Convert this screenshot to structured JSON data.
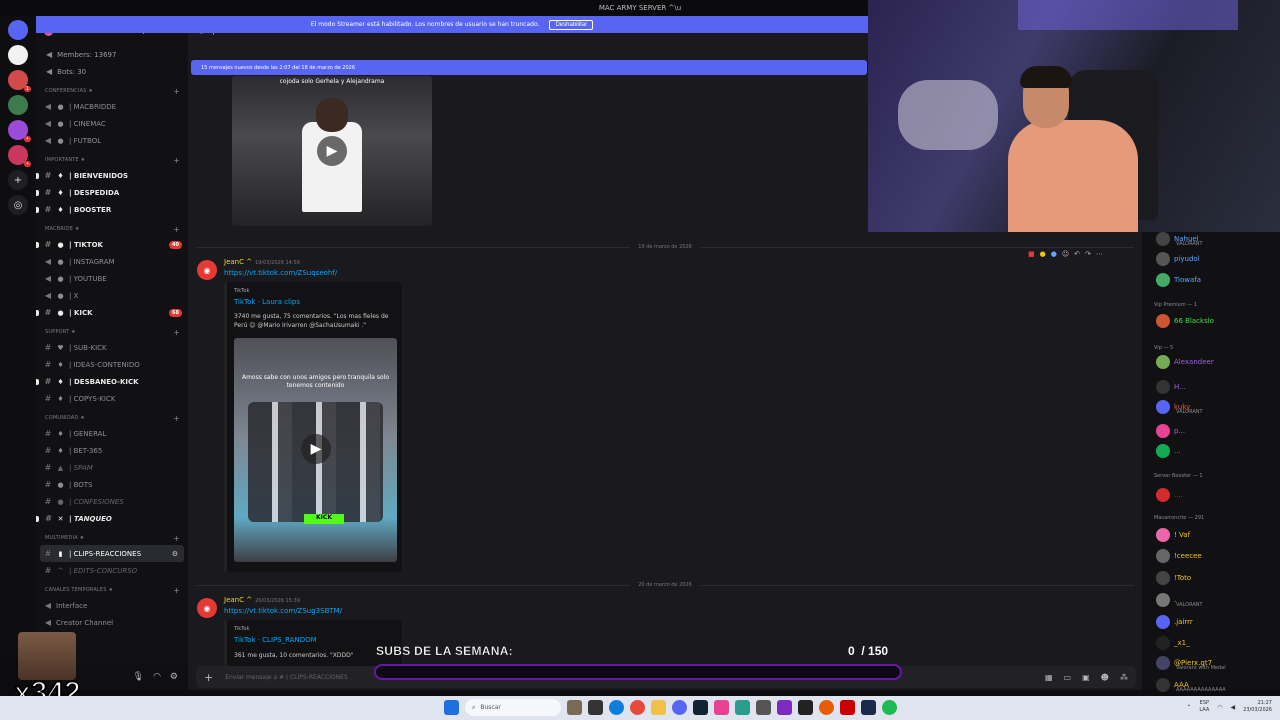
{
  "window": {
    "title": "MAC ARMY SERVER ^\\u"
  },
  "streamer_banner": {
    "text": "El modo Streamer está habilitado. Los nombres de usuario se han truncado.",
    "button": "Deshabilitar"
  },
  "server": {
    "name": "MAC ARMY SERVER ^\\u",
    "members": "Members: 13697",
    "bots": "Bots: 30"
  },
  "channel_header": {
    "name": "| CLIPS-REACCIONES"
  },
  "new_messages_bar": "15 mensajes nuevos desde las 2:07 del 18 de marzo de 2026",
  "sidebar": {
    "categories": [
      {
        "name": "CONFERENCIAS ★",
        "channels": [
          {
            "label": "| MACBRIDDE",
            "icon": "speaker-icon",
            "emoji": "●",
            "style": "normal"
          },
          {
            "label": "| CINEMAC",
            "icon": "speaker-icon",
            "emoji": "●",
            "style": "normal"
          },
          {
            "label": "| FUTBOL",
            "icon": "speaker-icon",
            "emoji": "●",
            "style": "normal"
          }
        ]
      },
      {
        "name": "IMPORTANTE ★",
        "channels": [
          {
            "label": "| BIENVENIDOS",
            "icon": "hash-icon",
            "emoji": "♦",
            "style": "bold"
          },
          {
            "label": "| DESPEDIDA",
            "icon": "hash-icon",
            "emoji": "♦",
            "style": "bold"
          },
          {
            "label": "| BOOSTER",
            "icon": "hash-icon",
            "emoji": "♦",
            "style": "bold"
          }
        ]
      },
      {
        "name": "MACBRIDE ★",
        "channels": [
          {
            "label": "| TIKTOK",
            "icon": "hash-icon",
            "emoji": "●",
            "style": "bold",
            "ping": "40"
          },
          {
            "label": "| INSTAGRAM",
            "icon": "speaker-icon",
            "emoji": "●",
            "style": "normal"
          },
          {
            "label": "| YOUTUBE",
            "icon": "speaker-icon",
            "emoji": "●",
            "style": "normal"
          },
          {
            "label": "| X",
            "icon": "speaker-icon",
            "emoji": "●",
            "style": "normal"
          },
          {
            "label": "| KICK",
            "icon": "hash-icon",
            "emoji": "●",
            "style": "bold",
            "ping": "68"
          }
        ]
      },
      {
        "name": "SUPPORT ★",
        "channels": [
          {
            "label": "| SUB-KICK",
            "icon": "hash-icon",
            "emoji": "♥",
            "style": "normal"
          },
          {
            "label": "| IDEAS-CONTENIDO",
            "icon": "hash-icon",
            "emoji": "♦",
            "style": "normal"
          },
          {
            "label": "| DESBANEO-KICK",
            "icon": "hash-icon",
            "emoji": "♦",
            "style": "bold"
          },
          {
            "label": "| COPYS-KICK",
            "icon": "hash-icon",
            "emoji": "♦",
            "style": "normal"
          }
        ]
      },
      {
        "name": "COMUNIDAD ★",
        "channels": [
          {
            "label": "| GENERAL",
            "icon": "hash-icon",
            "emoji": "♦",
            "style": "normal"
          },
          {
            "label": "| BET-365",
            "icon": "hash-icon",
            "emoji": "♦",
            "style": "normal"
          },
          {
            "label": "| SPAM",
            "icon": "hash-icon",
            "emoji": "▲",
            "style": "dim"
          },
          {
            "label": "| BOTS",
            "icon": "hash-icon",
            "emoji": "●",
            "style": "normal"
          },
          {
            "label": "| CONFESIONES",
            "icon": "hash-icon",
            "emoji": "●",
            "style": "italic"
          },
          {
            "label": "| TANQUEO",
            "icon": "hash-icon",
            "emoji": "✕",
            "style": "bold-italic"
          }
        ]
      },
      {
        "name": "MULTIMEDIA ★",
        "channels": [
          {
            "label": "| CLIPS-REACCIONES",
            "icon": "hash-icon",
            "emoji": "▮",
            "style": "active"
          },
          {
            "label": "| EDITS-CONCURSO",
            "icon": "hash-icon",
            "emoji": "^",
            "style": "italic"
          }
        ]
      },
      {
        "name": "CANALES TEMPORALES ★",
        "channels": [
          {
            "label": "Interface",
            "icon": "speaker-icon",
            "emoji": "",
            "style": "normal"
          },
          {
            "label": "Creator Channel",
            "icon": "speaker-icon",
            "emoji": "",
            "style": "normal"
          }
        ]
      }
    ]
  },
  "video1": {
    "caption": "cojoda solo Gerhela y Alejandrama"
  },
  "dates": [
    "19 de marzo de 2026",
    "20 de marzo de 2026"
  ],
  "message1": {
    "author": "JeanC ^",
    "timestamp": "19/03/2026 14:56",
    "link": "https://vt.tiktok.com/ZSuqseohf/",
    "embed_provider": "TikTok",
    "embed_title": "TikTok · Laura clips",
    "embed_desc_1": "3740 me gusta, 75 comentarios. \"Los mas fieles de",
    "embed_desc_2": "Perú 😊 @Mario Irivarren @SachaUsumaki .\"",
    "video_caption": "Amoss sabe con unos amigos pero tranquila solo tenemos contenido"
  },
  "message2": {
    "author": "JeanC ^",
    "timestamp": "20/03/2026 15:39",
    "link": "https://vt.tiktok.com/ZSug3SBTM/",
    "embed_provider": "TikTok",
    "embed_title": "TikTok · CLIPS_RANDOM",
    "embed_desc_1": "361 me gusta, 10 comentarios. \"XDDD\""
  },
  "composer": {
    "placeholder": "Enviar mensaje a # | CLIPS-REACCIONES"
  },
  "subs_overlay": {
    "title": "SUBS DE LA SEMANA:",
    "current": "0",
    "goal": "/ 150",
    "progress": 0
  },
  "emote_overlay": {
    "multiplier": "x342"
  },
  "members": {
    "groups": [
      {
        "name": "Vip Premium — 1"
      },
      {
        "name": "Vip — 5"
      },
      {
        "name": "Server Booster — 1"
      },
      {
        "name": "Macarroncito — 291"
      }
    ],
    "people": [
      {
        "name": "Nahuel",
        "sub": "VALORANT",
        "color": "#5aa9ff"
      },
      {
        "name": "piyudol",
        "sub": "",
        "color": "#5aa9ff"
      },
      {
        "name": "Tiowafa",
        "sub": "",
        "color": "#5aa9ff"
      },
      {
        "name": "66 Blackslo",
        "sub": "",
        "color": "#3ce04a"
      },
      {
        "name": "Alexandeer",
        "sub": "",
        "color": "#a25cf0"
      },
      {
        "name": "H...",
        "sub": "",
        "color": "#a25cf0"
      },
      {
        "name": "kuky",
        "sub": "VALORANT",
        "color": "#e8572f"
      },
      {
        "name": "p...",
        "sub": "",
        "color": "#a25cf0"
      },
      {
        "name": "...",
        "sub": "",
        "color": "#a25cf0"
      },
      {
        "name": "....",
        "sub": "",
        "color": "#d12b2b"
      },
      {
        "name": "! Vaf",
        "sub": "",
        "color": "#f0c419"
      },
      {
        "name": "!ceecee",
        "sub": "",
        "color": "#f0c419"
      },
      {
        "name": "!Toto",
        "sub": "",
        "color": "#f0c419"
      },
      {
        "name": ".",
        "sub": "VALORANT",
        "color": "#f0c419"
      },
      {
        "name": ".jairrr",
        "sub": "",
        "color": "#f0c419"
      },
      {
        "name": "_x1_",
        "sub": "",
        "color": "#f0c419"
      },
      {
        "name": "@Pierx.gt7",
        "sub": "Valorant with Medal",
        "color": "#f0c419"
      },
      {
        "name": "AAA",
        "sub": "AAAAAAAAAAAAAA",
        "color": "#f0c419"
      }
    ]
  },
  "taskbar": {
    "search": "Buscar",
    "lang": "ESP",
    "lang2": "LAA",
    "time": "21:27",
    "date": "23/03/2026"
  }
}
